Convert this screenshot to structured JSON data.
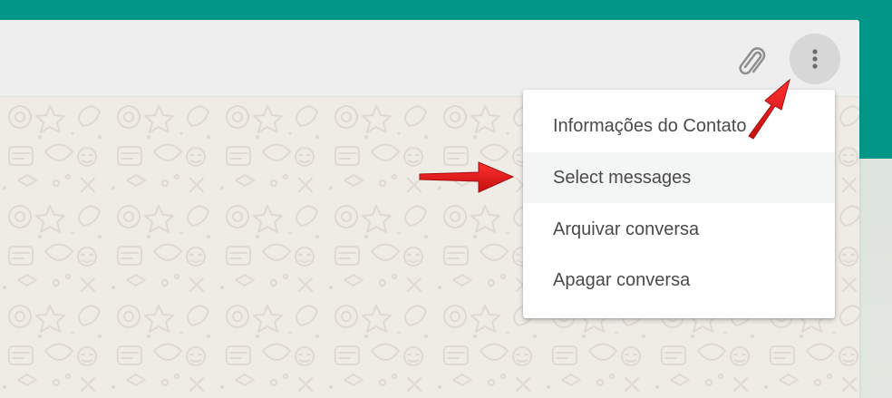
{
  "colors": {
    "brand_band": "#009688",
    "header_bg": "#eeeeee",
    "chat_bg": "#efebe5",
    "menu_hover_bg": "#f4f5f5",
    "annotation_arrow": "#e31b1b"
  },
  "header": {
    "attach_icon": "paperclip-icon",
    "menu_icon": "vertical-dots-icon"
  },
  "menu": {
    "items": [
      {
        "label": "Informações do Contato"
      },
      {
        "label": "Select messages"
      },
      {
        "label": "Arquivar conversa"
      },
      {
        "label": "Apagar conversa"
      }
    ],
    "highlighted_index": 1
  },
  "annotations": {
    "arrow_count": 2,
    "arrow_color": "#e31b1b"
  }
}
